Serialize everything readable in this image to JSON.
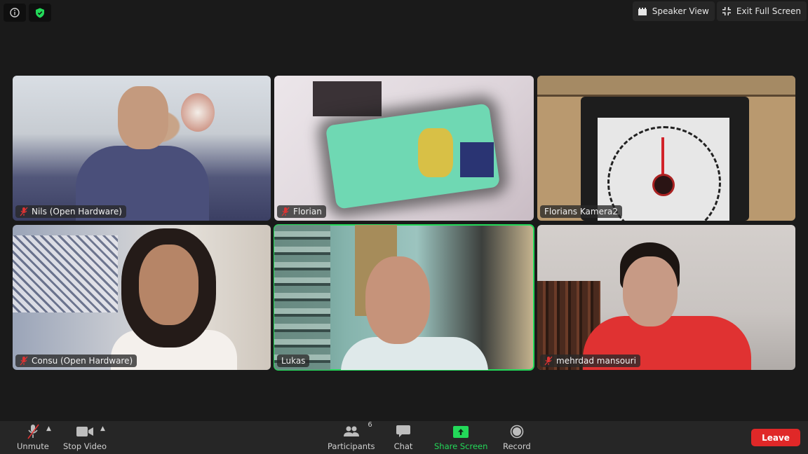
{
  "top_bar": {
    "info_icon": "info-icon",
    "security_icon": "shield-check-icon",
    "security_color": "#23d959",
    "speaker_view_label": "Speaker View",
    "exit_fullscreen_label": "Exit Full Screen"
  },
  "participants": [
    {
      "name": "Nils (Open Hardware)",
      "muted": true,
      "active": false
    },
    {
      "name": "Florian",
      "muted": true,
      "active": false
    },
    {
      "name": "Florians Kamera2",
      "muted": false,
      "active": false
    },
    {
      "name": "Consu (Open Hardware)",
      "muted": true,
      "active": false
    },
    {
      "name": "Lukas",
      "muted": false,
      "active": true
    },
    {
      "name": "mehrdad mansouri",
      "muted": true,
      "active": false
    }
  ],
  "toolbar": {
    "unmute_label": "Unmute",
    "stop_video_label": "Stop Video",
    "participants_label": "Participants",
    "participants_count": "6",
    "chat_label": "Chat",
    "share_screen_label": "Share Screen",
    "record_label": "Record",
    "leave_label": "Leave",
    "share_color": "#23d959",
    "leave_color": "#e02828"
  }
}
